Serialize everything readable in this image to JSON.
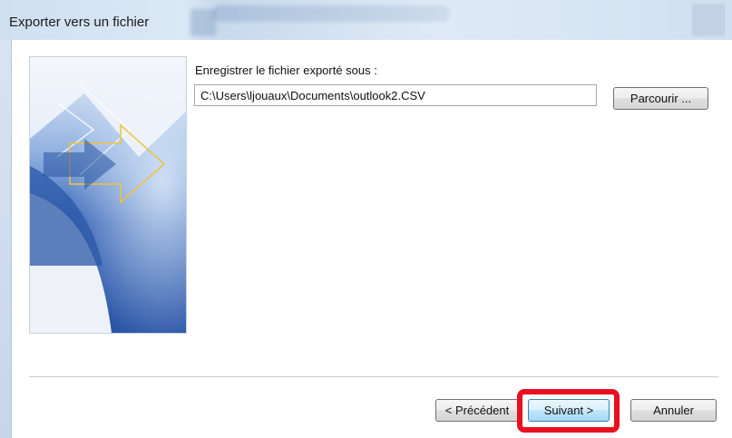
{
  "window": {
    "title": "Exporter vers un fichier"
  },
  "form": {
    "label": "Enregistrer le fichier exporté sous :",
    "path_value": "C:\\Users\\ljouaux\\Documents\\outlook2.CSV",
    "browse_label": "Parcourir ..."
  },
  "footer": {
    "prev_label": "< Précédent",
    "next_label": "Suivant >",
    "cancel_label": "Annuler"
  },
  "colors": {
    "highlight": "#e8101f",
    "banner_blue": "#2f5fb3",
    "arrow_yellow": "#f0c23a"
  }
}
